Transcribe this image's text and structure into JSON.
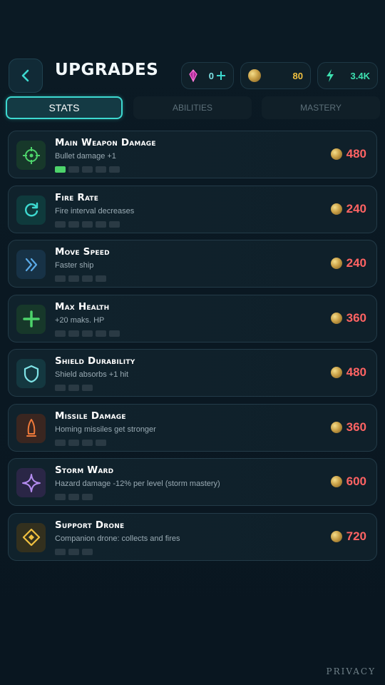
{
  "header": {
    "title": "UPGRADES",
    "resources": {
      "gems": "0",
      "coins": "80",
      "energy": "3.4K"
    }
  },
  "tabs": [
    {
      "label": "STATS",
      "active": true
    },
    {
      "label": "ABILITIES",
      "active": false
    },
    {
      "label": "MASTERY",
      "active": false
    }
  ],
  "upgrades": [
    {
      "title": "Main Weapon Damage",
      "desc": "Bullet damage +1",
      "price": "480",
      "level": 1,
      "max": 5,
      "icon": "crosshair-icon",
      "color": "#4dd36b"
    },
    {
      "title": "Fire Rate",
      "desc": "Fire interval decreases",
      "price": "240",
      "level": 0,
      "max": 5,
      "icon": "refresh-icon",
      "color": "#3dd9d0"
    },
    {
      "title": "Move Speed",
      "desc": "Faster ship",
      "price": "240",
      "level": 0,
      "max": 4,
      "icon": "double-chevron-icon",
      "color": "#5aa9e6"
    },
    {
      "title": "Max Health",
      "desc": "+20 maks. HP",
      "price": "360",
      "level": 0,
      "max": 5,
      "icon": "plus-icon",
      "color": "#4dd36b"
    },
    {
      "title": "Shield Durability",
      "desc": "Shield absorbs +1 hit",
      "price": "480",
      "level": 0,
      "max": 3,
      "icon": "shield-icon",
      "color": "#7fe3e6"
    },
    {
      "title": "Missile Damage",
      "desc": "Homing missiles get stronger",
      "price": "360",
      "level": 0,
      "max": 4,
      "icon": "missile-icon",
      "color": "#f07a3a"
    },
    {
      "title": "Storm Ward",
      "desc": "Hazard damage -12% per level (storm mastery)",
      "price": "600",
      "level": 0,
      "max": 3,
      "icon": "sparkle-icon",
      "color": "#b48cf0"
    },
    {
      "title": "Support Drone",
      "desc": "Companion drone: collects and fires",
      "price": "720",
      "level": 0,
      "max": 3,
      "icon": "diamond-icon",
      "color": "#f0c040"
    }
  ],
  "footer": {
    "privacy": "PRIVACY"
  }
}
